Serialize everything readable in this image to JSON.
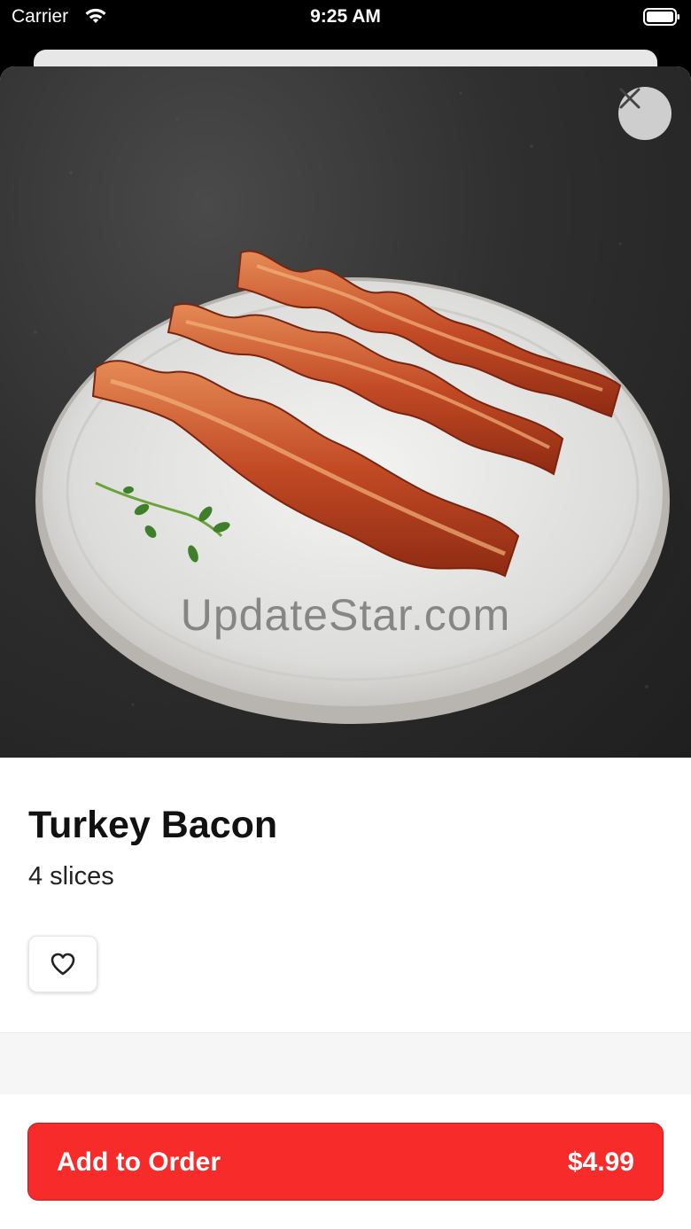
{
  "status_bar": {
    "carrier": "Carrier",
    "time": "9:25 AM"
  },
  "hero": {
    "watermark": "UpdateStar.com"
  },
  "item": {
    "title": "Turkey Bacon",
    "subtitle": "4 slices"
  },
  "actions": {
    "add_label": "Add to Order",
    "price": "$4.99"
  },
  "colors": {
    "accent": "#f82b2b",
    "background": "#ffffff",
    "text": "#111111"
  },
  "icons": {
    "close": "close-icon",
    "favorite": "heart-icon",
    "wifi": "wifi-icon",
    "battery": "battery-icon"
  }
}
